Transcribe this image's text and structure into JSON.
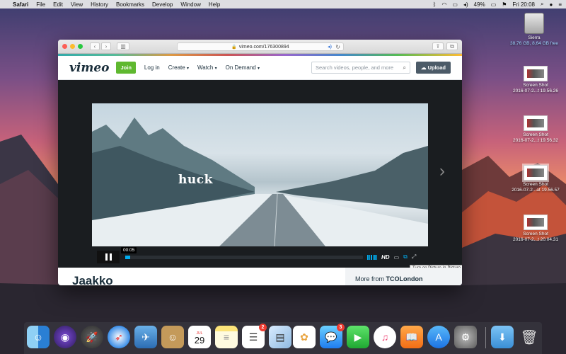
{
  "menubar": {
    "app": "Safari",
    "items": [
      "File",
      "Edit",
      "View",
      "History",
      "Bookmarks",
      "Develop",
      "Window",
      "Help"
    ],
    "battery": "49%",
    "clock": "Fri 20:08"
  },
  "desktop": {
    "drive": {
      "name": "Sierra",
      "info": "38,76 GB, 8,64 GB free"
    },
    "screenshots": [
      {
        "line1": "Screen Shot",
        "line2": "2016-07-2...t 19.56.26"
      },
      {
        "line1": "Screen Shot",
        "line2": "2016-07-2...t 19.56.32"
      },
      {
        "line1": "Screen Shot",
        "line2": "2016-07-2...at 19.56.57"
      },
      {
        "line1": "Screen Shot",
        "line2": "2016-07-2...t 20.04.31"
      }
    ]
  },
  "browser": {
    "url": "vimeo.com/176300894",
    "vimeo": {
      "logo": "vimeo",
      "join": "Join",
      "login": "Log in",
      "nav": [
        "Create",
        "Watch",
        "On Demand"
      ],
      "search_placeholder": "Search videos, people, and more",
      "upload": "Upload"
    },
    "video": {
      "overlay_text": "huck",
      "time": "00:05",
      "progress": 0.02,
      "quality": "HD",
      "tooltip": "Turn on Picture-in-Picture"
    },
    "below": {
      "title": "Jaakko",
      "more_from_prefix": "More from",
      "more_from_channel": "TCOLondon"
    }
  },
  "dock": {
    "calendar_month": "JUL",
    "calendar_day": "29",
    "reminders_badge": "2",
    "messages_badge": "3"
  }
}
